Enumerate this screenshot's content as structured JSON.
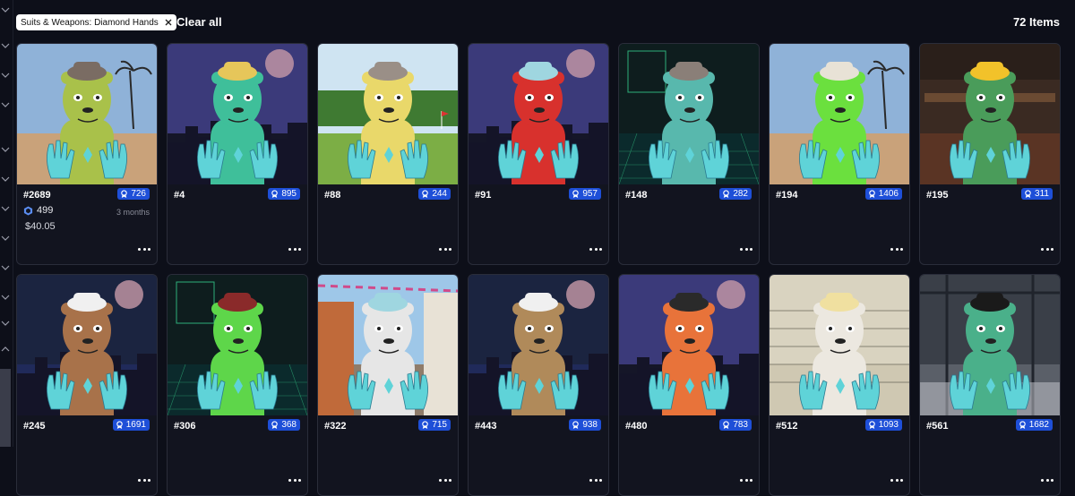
{
  "filters": {
    "chip_label": "Suits & Weapons: Diamond Hands",
    "clear_all_label": "Clear all"
  },
  "results": {
    "count_label": "72 Items"
  },
  "items": [
    {
      "id": "#2689",
      "rank": "726",
      "price": "499",
      "usd": "$40.05",
      "listed": "3 months",
      "bg": "beach",
      "fur": "#a9c14a",
      "hat": "#7a6c63"
    },
    {
      "id": "#4",
      "rank": "895",
      "bg": "night",
      "fur": "#3fbf9a",
      "hat": "#e6c65a"
    },
    {
      "id": "#88",
      "rank": "244",
      "bg": "golf",
      "fur": "#e9d86a",
      "hat": "#9a8f87"
    },
    {
      "id": "#91",
      "rank": "957",
      "bg": "night",
      "fur": "#d8312d",
      "hat": "#9fd6e0"
    },
    {
      "id": "#148",
      "rank": "282",
      "bg": "grid",
      "fur": "#58b8ad",
      "hat": "#8a7f78"
    },
    {
      "id": "#194",
      "rank": "1406",
      "bg": "beach",
      "fur": "#6be03e",
      "hat": "#e8e2d6"
    },
    {
      "id": "#195",
      "rank": "311",
      "bg": "bar",
      "fur": "#4a9c5a",
      "hat": "#f2c22a"
    },
    {
      "id": "#245",
      "rank": "1691",
      "bg": "harbor",
      "fur": "#a8724a",
      "hat": "#f0f0f0"
    },
    {
      "id": "#306",
      "rank": "368",
      "bg": "grid",
      "fur": "#5ed64a",
      "hat": "#8a2a2a"
    },
    {
      "id": "#322",
      "rank": "715",
      "bg": "street",
      "fur": "#e6e6e6",
      "hat": "#9fd6e0"
    },
    {
      "id": "#443",
      "rank": "938",
      "bg": "harbor",
      "fur": "#b08a5a",
      "hat": "#f0f0f0"
    },
    {
      "id": "#480",
      "rank": "783",
      "bg": "night",
      "fur": "#e8733a",
      "hat": "#2a2a2a"
    },
    {
      "id": "#512",
      "rank": "1093",
      "bg": "lineup",
      "fur": "#ece8e0",
      "hat": "#f0e0a0"
    },
    {
      "id": "#561",
      "rank": "1682",
      "bg": "warehouse",
      "fur": "#4ab08a",
      "hat": "#1a1a1a"
    }
  ],
  "colors": {
    "accent": "#1e4fd8",
    "background": "#0d0f19",
    "glove": "#5fd3d8"
  }
}
